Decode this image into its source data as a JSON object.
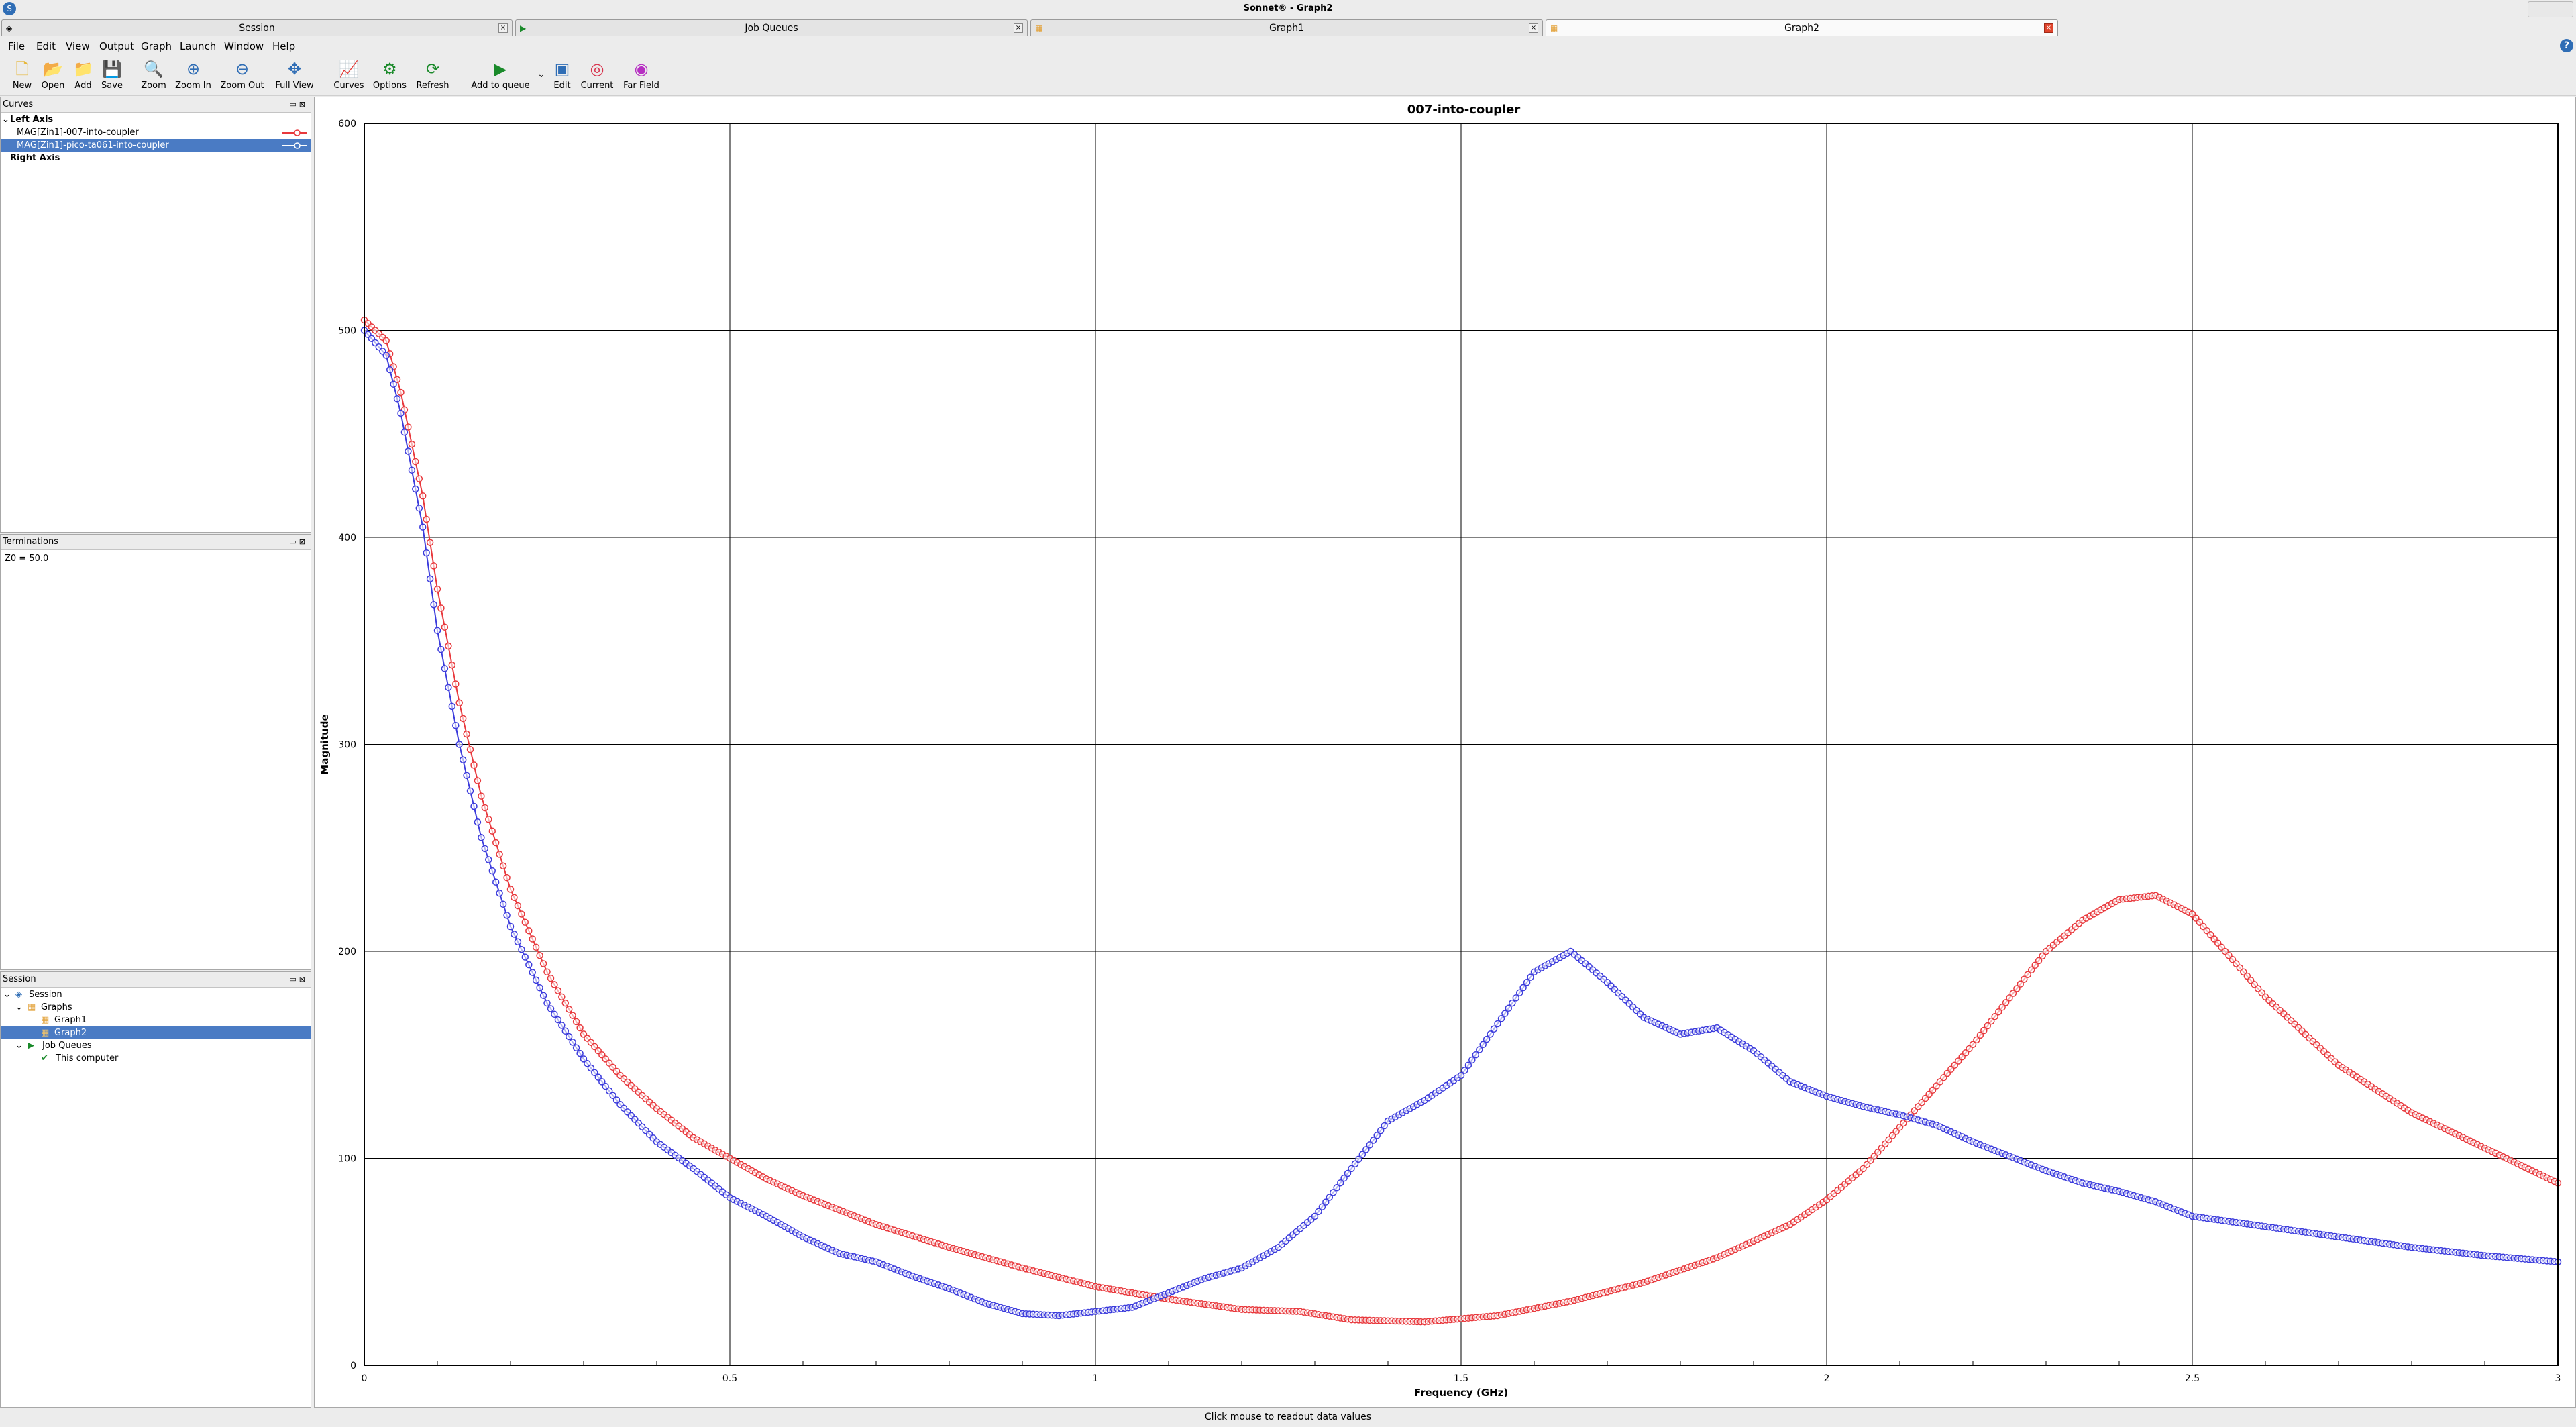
{
  "window": {
    "title": "Sonnet® - Graph2"
  },
  "tabs": [
    {
      "label": "Session",
      "icon": "session-icon"
    },
    {
      "label": "Job Queues",
      "icon": "job-queue-icon"
    },
    {
      "label": "Graph1",
      "icon": "graph-icon"
    },
    {
      "label": "Graph2",
      "icon": "graph-icon",
      "active": true
    }
  ],
  "menu": [
    "File",
    "Edit",
    "View",
    "Output",
    "Graph",
    "Launch",
    "Window",
    "Help"
  ],
  "toolbar": {
    "new": "New",
    "open": "Open",
    "add": "Add",
    "save": "Save",
    "zoom": "Zoom",
    "zoom_in": "Zoom In",
    "zoom_out": "Zoom Out",
    "full_view": "Full View",
    "curves": "Curves",
    "options": "Options",
    "refresh": "Refresh",
    "add_to_queue": "Add to queue",
    "edit": "Edit",
    "current": "Current",
    "far_field": "Far Field"
  },
  "curves_panel": {
    "title": "Curves",
    "left_axis": "Left Axis",
    "items": [
      {
        "label": "MAG[Zin1]-007-into-coupler",
        "color": "#e8383c"
      },
      {
        "label": "MAG[Zin1]-pico-ta061-into-coupler",
        "color": "#3b3bdc"
      }
    ],
    "right_axis": "Right Axis"
  },
  "terminations_panel": {
    "title": "Terminations",
    "value": "Z0 = 50.0"
  },
  "session_panel": {
    "title": "Session",
    "session": "Session",
    "graphs": "Graphs",
    "graph1": "Graph1",
    "graph2": "Graph2",
    "job_queues": "Job Queues",
    "this_computer": "This computer"
  },
  "status_text": "Click mouse to readout data values",
  "chart_data": {
    "type": "scatter",
    "title": "007-into-coupler",
    "xlabel": "Frequency (GHz)",
    "ylabel": "Magnitude",
    "xlim": [
      0,
      3
    ],
    "ylim": [
      0,
      600
    ],
    "x_ticks": [
      "0",
      "0.5",
      "1",
      "1.5",
      "2",
      "2.5",
      "3"
    ],
    "y_ticks": [
      "0",
      "100",
      "200",
      "300",
      "400",
      "500",
      "600"
    ],
    "grid": true,
    "series": [
      {
        "name": "MAG[Zin1]-007-into-coupler",
        "color": "#e8383c",
        "points": [
          [
            0,
            505
          ],
          [
            0.03,
            495
          ],
          [
            0.05,
            470
          ],
          [
            0.08,
            420
          ],
          [
            0.1,
            375
          ],
          [
            0.13,
            320
          ],
          [
            0.16,
            275
          ],
          [
            0.2,
            230
          ],
          [
            0.25,
            190
          ],
          [
            0.3,
            160
          ],
          [
            0.35,
            140
          ],
          [
            0.4,
            124
          ],
          [
            0.45,
            110
          ],
          [
            0.5,
            100
          ],
          [
            0.55,
            90
          ],
          [
            0.6,
            82
          ],
          [
            0.7,
            68
          ],
          [
            0.8,
            57
          ],
          [
            0.9,
            47
          ],
          [
            1.0,
            38
          ],
          [
            1.1,
            32
          ],
          [
            1.2,
            27
          ],
          [
            1.28,
            26
          ],
          [
            1.35,
            22
          ],
          [
            1.45,
            21
          ],
          [
            1.55,
            24
          ],
          [
            1.65,
            31
          ],
          [
            1.75,
            40
          ],
          [
            1.85,
            52
          ],
          [
            1.95,
            68
          ],
          [
            2.0,
            80
          ],
          [
            2.05,
            95
          ],
          [
            2.1,
            115
          ],
          [
            2.2,
            155
          ],
          [
            2.3,
            200
          ],
          [
            2.35,
            215
          ],
          [
            2.4,
            225
          ],
          [
            2.45,
            227
          ],
          [
            2.5,
            218
          ],
          [
            2.55,
            198
          ],
          [
            2.6,
            178
          ],
          [
            2.7,
            145
          ],
          [
            2.8,
            122
          ],
          [
            2.9,
            105
          ],
          [
            3.0,
            88
          ]
        ]
      },
      {
        "name": "MAG[Zin1]-pico-ta061-into-coupler",
        "color": "#3b3bdc",
        "points": [
          [
            0,
            500
          ],
          [
            0.03,
            488
          ],
          [
            0.05,
            460
          ],
          [
            0.08,
            405
          ],
          [
            0.1,
            355
          ],
          [
            0.13,
            300
          ],
          [
            0.16,
            255
          ],
          [
            0.2,
            212
          ],
          [
            0.25,
            175
          ],
          [
            0.3,
            148
          ],
          [
            0.35,
            126
          ],
          [
            0.4,
            108
          ],
          [
            0.45,
            95
          ],
          [
            0.5,
            81
          ],
          [
            0.55,
            72
          ],
          [
            0.6,
            62
          ],
          [
            0.65,
            54
          ],
          [
            0.7,
            50
          ],
          [
            0.75,
            43
          ],
          [
            0.8,
            37
          ],
          [
            0.85,
            30
          ],
          [
            0.9,
            25
          ],
          [
            0.95,
            24
          ],
          [
            1.0,
            26
          ],
          [
            1.05,
            28
          ],
          [
            1.1,
            35
          ],
          [
            1.15,
            42
          ],
          [
            1.2,
            47
          ],
          [
            1.25,
            57
          ],
          [
            1.3,
            72
          ],
          [
            1.35,
            95
          ],
          [
            1.4,
            118
          ],
          [
            1.45,
            128
          ],
          [
            1.5,
            140
          ],
          [
            1.55,
            165
          ],
          [
            1.6,
            190
          ],
          [
            1.65,
            200
          ],
          [
            1.7,
            185
          ],
          [
            1.75,
            168
          ],
          [
            1.8,
            160
          ],
          [
            1.85,
            163
          ],
          [
            1.9,
            152
          ],
          [
            1.95,
            137
          ],
          [
            2.0,
            130
          ],
          [
            2.05,
            125
          ],
          [
            2.1,
            121
          ],
          [
            2.15,
            116
          ],
          [
            2.2,
            108
          ],
          [
            2.25,
            101
          ],
          [
            2.3,
            94
          ],
          [
            2.35,
            88
          ],
          [
            2.4,
            84
          ],
          [
            2.45,
            79
          ],
          [
            2.5,
            72
          ],
          [
            2.6,
            67
          ],
          [
            2.7,
            62
          ],
          [
            2.8,
            57
          ],
          [
            2.9,
            53
          ],
          [
            3.0,
            50
          ]
        ]
      }
    ]
  }
}
